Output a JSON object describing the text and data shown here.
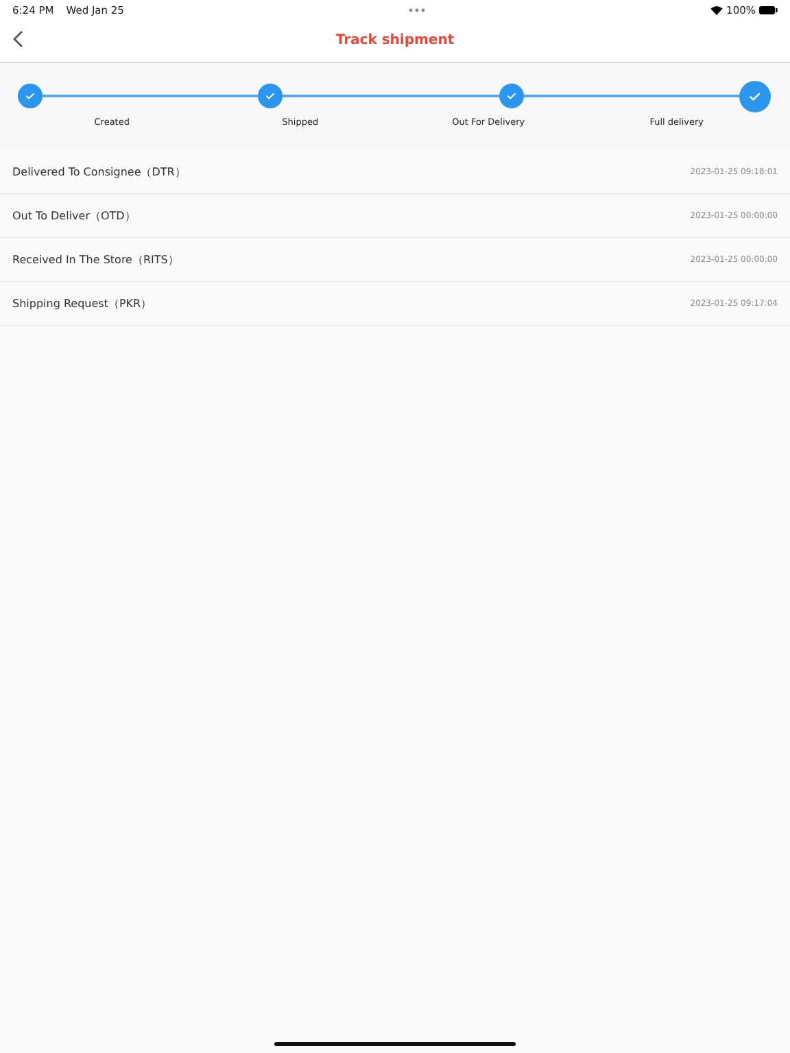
{
  "status_bar": {
    "time": "6:24 PM",
    "date": "Wed Jan 25",
    "battery": "100%"
  },
  "header": {
    "title": "Track shipment"
  },
  "steps": [
    {
      "label": "Created",
      "done": true,
      "current": false
    },
    {
      "label": "Shipped",
      "done": true,
      "current": false
    },
    {
      "label": "Out For Delivery",
      "done": true,
      "current": false
    },
    {
      "label": "Full delivery",
      "done": true,
      "current": true
    }
  ],
  "events": [
    {
      "status": "Delivered To Consignee（DTR）",
      "time": "2023-01-25 09:18:01"
    },
    {
      "status": "Out To Deliver（OTD）",
      "time": "2023-01-25 00:00:00"
    },
    {
      "status": "Received In The Store（RITS）",
      "time": "2023-01-25 00:00:00"
    },
    {
      "status": "Shipping Request（PKR）",
      "time": "2023-01-25 09:17:04"
    }
  ]
}
